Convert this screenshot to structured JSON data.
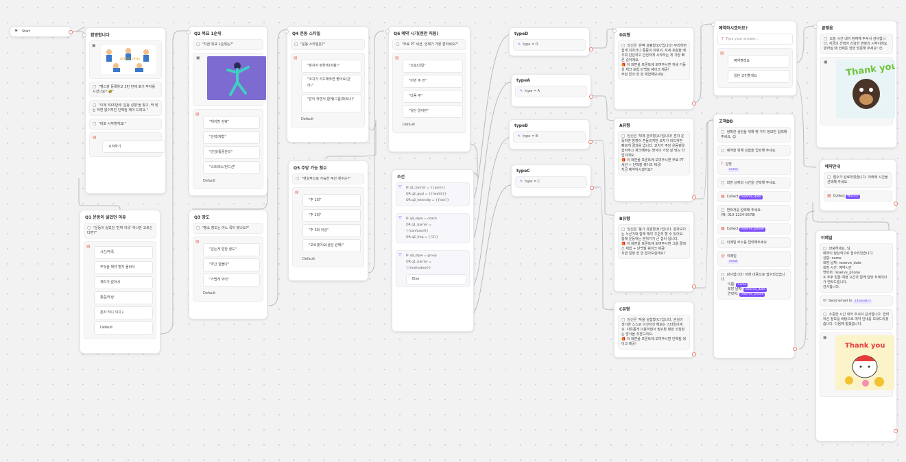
{
  "start": {
    "label": "Start"
  },
  "n_welcome": {
    "title": "환영합니다",
    "b1": "\"헬스장 등록하고 3번 만에 포기 부지를 시셨나요? 🤣\"",
    "b2": "\"이제 30초만에 '운동 성향'을 찾고, 딱 맞는 하면 없이무진 단백질 헤어 드려요.\"",
    "b3": "\"바로 시작할게요!\"",
    "btn": "시작하기"
  },
  "n_q1": {
    "title": "Q1 운동이 싫었던 이유",
    "q": "\"운동이 싫었던 '진짜 이유' 하나만 고르신다면?\"",
    "opts": [
      "시간/부족",
      "무엇을 해야 할지 몰라서",
      "재미가 없어서",
      "통증/부상",
      "혼자 하니 의지↓"
    ],
    "default": "Default"
  },
  "n_q2": {
    "title": "Q2 목표 1순위",
    "q": "\"지금 목표 1순위는?\"",
    "opts": [
      "\"체지방 감량\"",
      "\"근력/체형\"",
      "\"건강/통증관리\"",
      "\"스트레스/컨디션\""
    ],
    "default": "Default"
  },
  "n_q3": {
    "title": "Q3 장도",
    "q": "\"평소 장도는 어느 쪽이 맞나요?\"",
    "opts": [
      "\"걷는게 편한 정도\"",
      "\"약간 힘들다\"",
      "\"가볍게 무리\""
    ],
    "default": "Default"
  },
  "n_q4": {
    "title": "Q4 운동 스타일",
    "q": "\"운동 스타일은?\"",
    "opts": [
      "\"혼자서 편하게(자율)\"",
      "\"코치가 리드해주면 좋아요(관리)\"",
      "\"같이 하면서 함께(그룹/파트너)\""
    ],
    "default": "Default"
  },
  "n_q5": {
    "title": "Q5 주당 가능 횟수",
    "q": "\"현실적으로 가능한 주간 횟수는?\"",
    "opts": [
      "\"주 1회\"",
      "\"주 2회\"",
      "\"주 3회 이상\"",
      "\"모르겠어요(상담 원해)\""
    ],
    "default": "Default"
  },
  "n_q6": {
    "title": "Q6 예약 시기(현안 허용)",
    "q": "\"무료 PT 세션, 언제가 가장 편하세요?\"",
    "opts": [
      "\"오늘/내일\"",
      "\"이번 주 안\"",
      "\"다음 주\"",
      "\"일단 알아만\""
    ],
    "default": "Default"
  },
  "n_cond": {
    "title": "조건",
    "g1": [
      "IF  q1_barrier  =  {{pain}}",
      "OR  q2_goal  =  {{health}}",
      "OR  q3_intensity  =  {{low}}"
    ],
    "g2": [
      "IF  q4_style  =  coach",
      "OR  q1_barrier  =",
      "{{confused}}",
      "OR  q5_freq  =  {{3}}"
    ],
    "g3": [
      "IF  q4_style  =  group",
      "OR  q1_barrier  =",
      "{{motivation}}"
    ],
    "else": "Else"
  },
  "n_typeD": {
    "title": "typeD",
    "val": "type = D"
  },
  "n_typeA": {
    "title": "typeA",
    "val": "type = A"
  },
  "n_typeB": {
    "title": "typeB",
    "val": "type = B"
  },
  "n_typeC": {
    "title": "typeC",
    "val": "type = C"
  },
  "n_D": {
    "title": "D유형",
    "text": "당신은 '완벽 설렘형(D)'입니다! 무리하면 쉽게 지치거나 통증이 쉬워서, 자세·호흡을 배우며 단단하고 안전하게 시작하는 게 가장 빠른 길이에요.\n🎁 이 화면을 프론트에 보여주시면 자세 가동성 체크 포함 단백질 쉐이크 제공!\n부담 없이 한 번 체험해보세요."
  },
  "n_A": {
    "title": "A유형",
    "text": "당신은 '체계 관리형(A)'입니다! 혼자 운동하면 방향이 흔들리지만 코치가 리드하면 빠르게 결과를 냅니다. 코치가 주당 운동량을 잡아주고 체크해주는 방식이 가장 잘 맞는 타입이에요.\n🎁 이 화면을 프론트에 보여주시면 무료 PT 세션 + 단백질 쉐이크 제공!\n지금 예약하시겠어요?"
  },
  "n_B": {
    "title": "B유형",
    "text": "당신은 '동기 유발형(B)'입니다. 혼자보다는 누군가와 함께 해야 꾸준히 할 수 있어요. 함께 운동하는 분위기가 큰 힘이 됩니다.\n🎁 이 화면을 프론트에 보여주시면 그룹 클래스 체험 + 단백질 쉐이크 제공!\n지금 일정 한 번 잡아보실래요?"
  },
  "n_C": {
    "title": "C유형",
    "text": "당신은 '자율 실험형(C)'입니다. 관심이 생기면 스스로 이것저것 해보는 스타일이에요. 자유롭게 이용하면서 필요할 때만 코칭받는 방식을 추천드려요.\n🎁 이 화면을 프론트에 보여주시면 단백질 쉐이크 제공!"
  },
  "n_collect": {
    "title": "고객DB",
    "b1": "정확한 상담을 위해 몇 가지 정보만 입력해 주세요. 😊",
    "b2": "예약을 위해 성함을 입력해 주세요.",
    "name_label": "성명",
    "name_tag": "name",
    "b3": "희망 날짜와 시간을 선택해 주세요.",
    "collect1": "Collect",
    "tag1": "reserve_date",
    "b4": "연락처를 입력해 주세요.\n(예: 010-1234-5678)",
    "collect2": "Collect",
    "tag2": "reserve_phone",
    "b5": "이메일 주소를 입력해주세요",
    "email_label": "이메일",
    "email_tag": "email",
    "b6": "감사합니다! 아래 내용으로 접수되었습니다.",
    "l_name": "이름:",
    "v_name": "name",
    "l_date": "희망 날짜:",
    "v_date": "reserve_date",
    "l_phone": "연락처:",
    "v_phone": "reserve_phone"
  },
  "n_ask": {
    "title": "예약하시겠어요?",
    "placeholder": "Type your answer...",
    "opt1": "예약할래요",
    "opt2": "일단 고민할게요"
  },
  "n_thanks1": {
    "title": "끝맺음",
    "text": "오늘 시간 내어 참여해 주셔서 감사합니다. 지금의 선택이 건강한 변화의 시작이에요. 편하실 때 언제든 한번 방문해 주세요! 😊",
    "img": "Thank you"
  },
  "n_resv": {
    "title": "예약안내",
    "text": "접수가 완료되었습니다. 아래에 시간을 선택해 주세요.",
    "collect": "Collect",
    "tag": "예약시간"
  },
  "n_email": {
    "title": "이메일",
    "text": "안녕하세요, 님.\n예약이 정상적으로 접수되었습니다.\n성함: name\n희망 날짜: reserve_date\n희망 시간: 예약시간\n연락처: reserve_phone\n※ 추후 방문 예정 시간과 함께 담당 트레이너가 연락드립니다.\n감사합니다.",
    "send": "Send email to",
    "send_tag": "{{email}}",
    "text2": "소중한 시간 내어 주셔서 감사합니다. 입력하신 정보를 바탕으로 예약 안내를 보내드리겠습니다. 다음에 뵙겠습니다.",
    "img": "Thank you"
  },
  "colors": {
    "accent": "#7c4dff",
    "port": "#e57a6a",
    "edge": "#b9b9c0"
  },
  "icons": [
    "message-icon",
    "image-icon",
    "choice-icon",
    "condition-icon",
    "variable-icon",
    "email-icon",
    "collect-icon"
  ]
}
